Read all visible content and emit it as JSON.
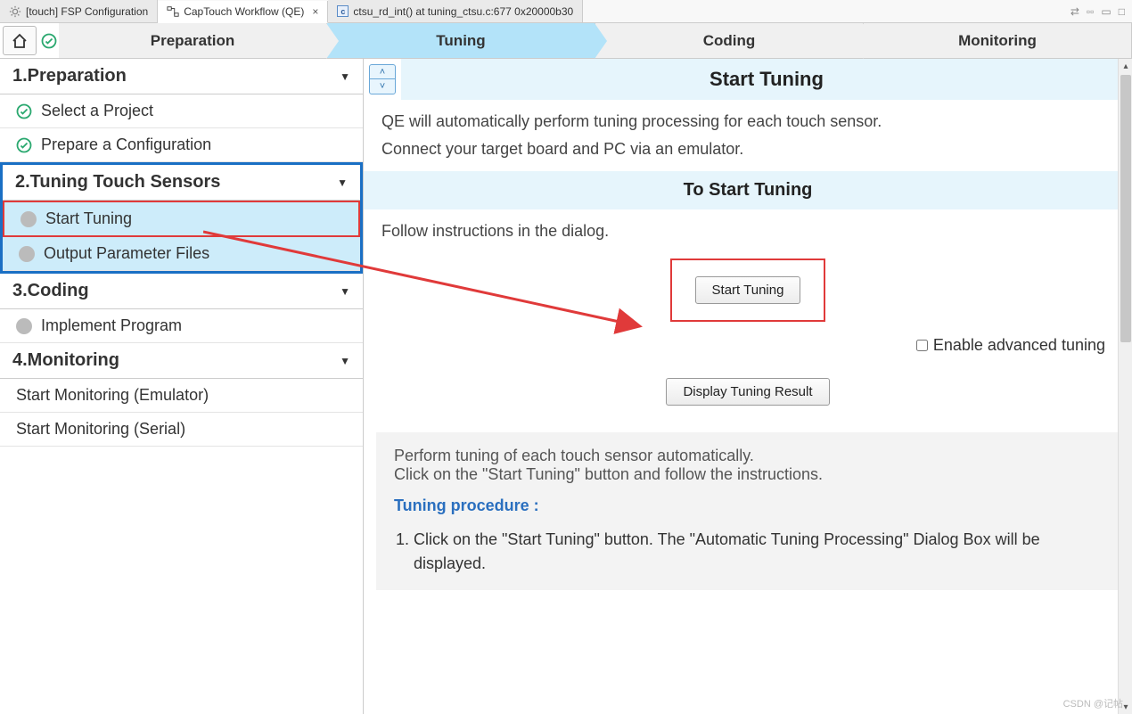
{
  "tabs": {
    "t0": "[touch] FSP Configuration",
    "t1": "CapTouch Workflow (QE)",
    "t2": "ctsu_rd_int() at tuning_ctsu.c:677 0x20000b30"
  },
  "workflow": {
    "s0": "Preparation",
    "s1": "Tuning",
    "s2": "Coding",
    "s3": "Monitoring"
  },
  "sidebar": {
    "h1": "1.Preparation",
    "i1a": "Select a Project",
    "i1b": "Prepare a Configuration",
    "h2": "2.Tuning Touch Sensors",
    "i2a": "Start Tuning",
    "i2b": "Output Parameter Files",
    "h3": "3.Coding",
    "i3a": "Implement Program",
    "h4": "4.Monitoring",
    "i4a": "Start Monitoring (Emulator)",
    "i4b": "Start Monitoring (Serial)"
  },
  "content": {
    "title1": "Start Tuning",
    "desc1a": "QE will automatically perform tuning processing for each touch sensor.",
    "desc1b": "Connect your target board and PC via an emulator.",
    "title2": "To Start Tuning",
    "desc2": "Follow instructions in the dialog.",
    "startBtn": "Start Tuning",
    "advChk": "Enable advanced tuning",
    "resultBtn": "Display Tuning Result",
    "info1": "Perform tuning of each touch sensor automatically.",
    "info2": "Click on the \"Start Tuning\" button and follow the instructions.",
    "procTitle": "Tuning procedure :",
    "step1": "Click on the \"Start Tuning\" button. The \"Automatic Tuning Processing\" Dialog Box will be displayed."
  },
  "watermark": "CSDN @记帖"
}
